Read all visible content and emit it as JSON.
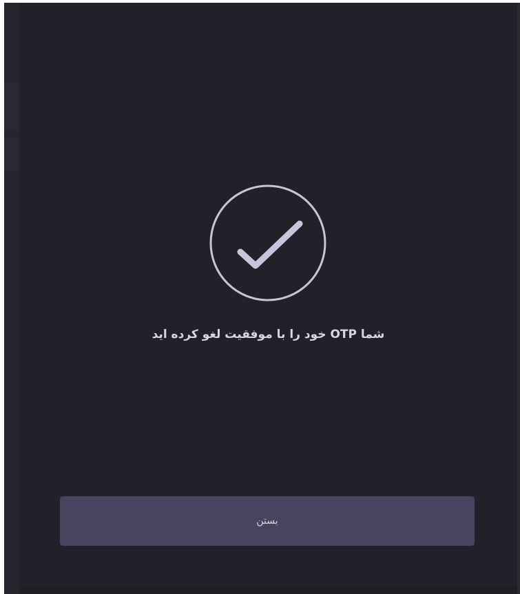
{
  "modal": {
    "icon": "check-circle-icon",
    "message": "شما OTP خود را با موفقیت لغو کرده اید",
    "close_label": "بستن"
  },
  "colors": {
    "background": "#1e1e25",
    "modal_background": "#21212a",
    "icon_stroke": "#c9c4d9",
    "text": "#d9d6e2",
    "button_background": "#48435f"
  }
}
